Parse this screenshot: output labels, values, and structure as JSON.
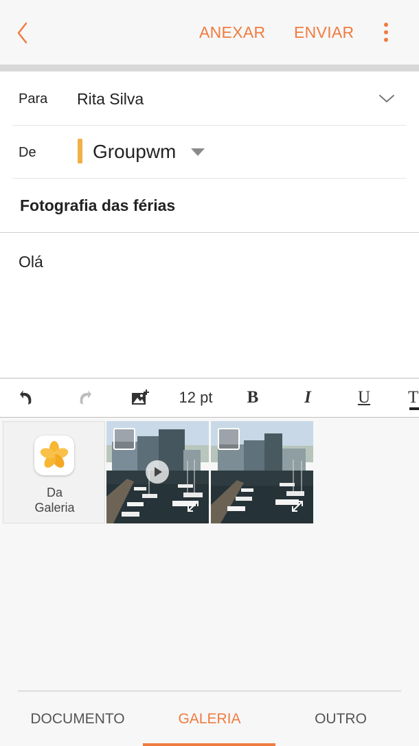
{
  "header": {
    "attach_label": "ANEXAR",
    "send_label": "ENVIAR",
    "accent_color": "#f07b3f"
  },
  "compose": {
    "to_label": "Para",
    "to_value": "Rita Silva",
    "from_label": "De",
    "from_account": "Groupwm",
    "subject": "Fotografia das férias",
    "body": "Olá"
  },
  "toolbar": {
    "font_size": "12 pt",
    "bold": "B",
    "italic": "I",
    "underline": "U",
    "text_color": "T"
  },
  "picker": {
    "gallery_label_line1": "Da",
    "gallery_label_line2": "Galeria",
    "thumbnails": [
      {
        "type": "video",
        "selected": false
      },
      {
        "type": "image",
        "selected": false
      }
    ]
  },
  "tabs": {
    "items": [
      "DOCUMENTO",
      "GALERIA",
      "OUTRO"
    ],
    "active": "GALERIA"
  }
}
